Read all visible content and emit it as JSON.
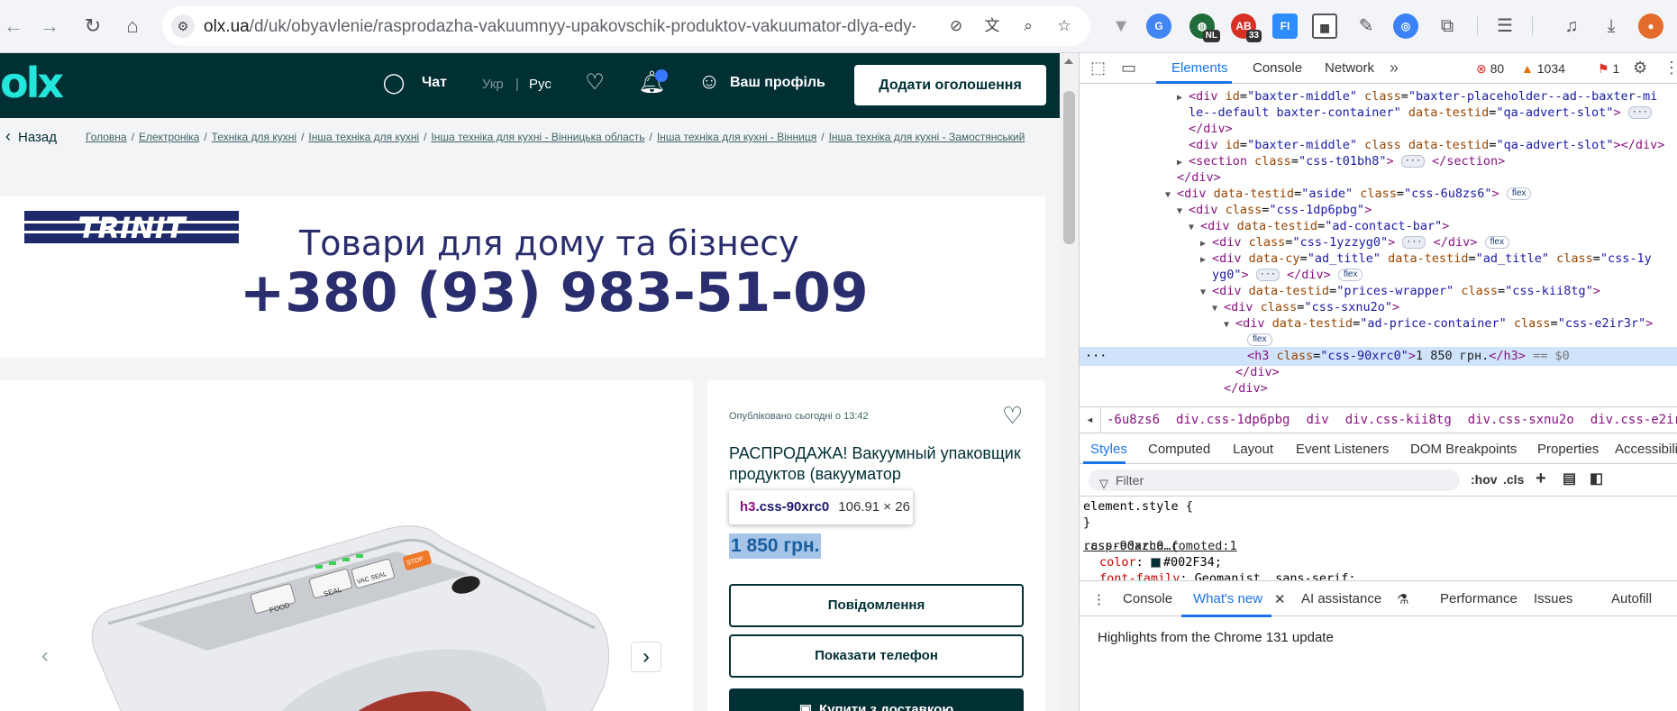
{
  "browser": {
    "url_host": "olx.ua",
    "url_path": "/d/uk/obyavlenie/rasprodazha-vakuumnyy-upakovschik-produktov-vakuumator-dlya-edy-IDMFj...",
    "extensions": [
      {
        "name": "google-translate-ext",
        "label": "G",
        "color": "#4285f4"
      },
      {
        "name": "vpn-ext",
        "label": "NL",
        "color": "#1f6b3a"
      },
      {
        "name": "adblock-ext",
        "label": "33",
        "color": "#d93025"
      },
      {
        "name": "fi-ext",
        "label": "FI",
        "color": "#2d8cff"
      },
      {
        "name": "qr-ext",
        "label": "QR",
        "color": "#555555"
      }
    ]
  },
  "olx": {
    "logo": "olx",
    "chat": "Чат",
    "lang_ukr": "Укр",
    "lang_sep": "|",
    "lang_rus": "Рус",
    "profile": "Ваш профіль",
    "post_ad": "Додати оголошення",
    "back": "Назад",
    "breadcrumbs": [
      "Головна",
      "Електроніка",
      "Техніка для кухні",
      "Інша техніка для кухні",
      "Інша техніка для кухні - Вінницька область",
      "Інша техніка для кухні - Вінниця",
      "Інша техніка для кухні - Замостянський"
    ],
    "banner": {
      "brand": "TRINIT",
      "line1": "Товари для дому та бізнесу",
      "phone": "+380 (93) 983-51-09"
    },
    "product_labels": {
      "food": "FOOD",
      "seal": "SEAL",
      "vac_seal": "VAC SEAL",
      "stop": "STOP"
    },
    "ad": {
      "posted": "Опубліковано сьогодні о 13:42",
      "title": "РАСПРОДАЖА! Вакуумный упаковщик продуктов (вакууматор",
      "price": "1 850 грн.",
      "btn_message": "Повідомлення",
      "btn_phone": "Показати телефон",
      "btn_buy": "Купити з доставкою"
    },
    "tooltip": {
      "tag": "h3",
      "cls": ".css-90xrc0",
      "dims": "106.91 × 26"
    }
  },
  "devtools": {
    "tabs": [
      "Elements",
      "Console",
      "Network"
    ],
    "errors": "80",
    "warnings": "1034",
    "issues": "1",
    "dom": [
      {
        "indent": 0,
        "tri": "▶",
        "html": "<span class='t-tag'>&lt;div</span> <span class='t-attr'>id</span>=<span class='t-val'>\"baxter-middle\"</span> <span class='t-attr'>class</span>=<span class='t-val'>\"baxter-placeholder--ad--baxter-mi</span>"
      },
      {
        "indent": 0,
        "tri": "",
        "html": "<span class='t-val'>le--default baxter-container\"</span> <span class='t-attr'>data-testid</span>=<span class='t-val'>\"qa-advert-slot\"</span><span class='t-tag'>&gt;</span> <span class='t-ell'>···</span>"
      },
      {
        "indent": 0,
        "tri": "",
        "html": "<span class='t-tag'>&lt;/div&gt;</span>"
      },
      {
        "indent": 0,
        "tri": "",
        "html": "<span class='t-tag'>&lt;div</span> <span class='t-attr'>id</span>=<span class='t-val'>\"baxter-middle\"</span> <span class='t-attr'>class</span> <span class='t-attr'>data-testid</span>=<span class='t-val'>\"qa-advert-slot\"</span><span class='t-tag'>&gt;&lt;/div&gt;</span>"
      },
      {
        "indent": 0,
        "tri": "▶",
        "html": "<span class='t-tag'>&lt;section</span> <span class='t-attr'>class</span>=<span class='t-val'>\"css-t01bh8\"</span><span class='t-tag'>&gt;</span> <span class='t-ell'>···</span> <span class='t-tag'>&lt;/section&gt;</span>"
      },
      {
        "indent": -1,
        "tri": "",
        "html": "<span class='t-tag'>&lt;/div&gt;</span>"
      },
      {
        "indent": -1,
        "tri": "▼",
        "html": "<span class='t-tag'>&lt;div</span> <span class='t-attr'>data-testid</span>=<span class='t-val'>\"aside\"</span> <span class='t-attr'>class</span>=<span class='t-val'>\"css-6u8zs6\"</span><span class='t-tag'>&gt;</span> <span class='t-badge'>flex</span>"
      },
      {
        "indent": 0,
        "tri": "▼",
        "html": "<span class='t-tag'>&lt;div</span> <span class='t-attr'>class</span>=<span class='t-val'>\"css-1dp6pbg\"</span><span class='t-tag'>&gt;</span>"
      },
      {
        "indent": 1,
        "tri": "▼",
        "html": "<span class='t-tag'>&lt;div</span> <span class='t-attr'>data-testid</span>=<span class='t-val'>\"ad-contact-bar\"</span><span class='t-tag'>&gt;</span>"
      },
      {
        "indent": 2,
        "tri": "▶",
        "html": "<span class='t-tag'>&lt;div</span> <span class='t-attr'>class</span>=<span class='t-val'>\"css-1yzzyg0\"</span><span class='t-tag'>&gt;</span> <span class='t-ell'>···</span> <span class='t-tag'>&lt;/div&gt;</span> <span class='t-badge'>flex</span>"
      },
      {
        "indent": 2,
        "tri": "▶",
        "html": "<span class='t-tag'>&lt;div</span> <span class='t-attr'>data-cy</span>=<span class='t-val'>\"ad_title\"</span> <span class='t-attr'>data-testid</span>=<span class='t-val'>\"ad_title\"</span> <span class='t-attr'>class</span>=<span class='t-val'>\"css-1y</span>"
      },
      {
        "indent": 2,
        "tri": "",
        "html": "<span class='t-val'>yg0\"</span><span class='t-tag'>&gt;</span> <span class='t-ell'>···</span> <span class='t-tag'>&lt;/div&gt;</span> <span class='t-badge'>flex</span>"
      },
      {
        "indent": 2,
        "tri": "▼",
        "html": "<span class='t-tag'>&lt;div</span> <span class='t-attr'>data-testid</span>=<span class='t-val'>\"prices-wrapper\"</span> <span class='t-attr'>class</span>=<span class='t-val'>\"css-kii8tg\"</span><span class='t-tag'>&gt;</span>"
      },
      {
        "indent": 3,
        "tri": "▼",
        "html": "<span class='t-tag'>&lt;div</span> <span class='t-attr'>class</span>=<span class='t-val'>\"css-sxnu2o\"</span><span class='t-tag'>&gt;</span>"
      },
      {
        "indent": 4,
        "tri": "▼",
        "html": "<span class='t-tag'>&lt;div</span> <span class='t-attr'>data-testid</span>=<span class='t-val'>\"ad-price-container\"</span> <span class='t-attr'>class</span>=<span class='t-val'>\"css-e2ir3r\"</span><span class='t-tag'>&gt;</span>"
      },
      {
        "indent": 5,
        "tri": "",
        "html": "<span class='t-badge'>flex</span>"
      },
      {
        "indent": 5,
        "tri": "",
        "sel": true,
        "html": "<span class='t-tag'>&lt;h3</span> <span class='t-attr'>class</span>=<span class='t-val'>\"css-90xrc0\"</span><span class='t-tag'>&gt;</span><span class='t-txt'>1 850 грн.</span><span class='t-tag'>&lt;/h3&gt;</span> <span class='t-eq'>== $0</span>"
      },
      {
        "indent": 4,
        "tri": "",
        "html": "<span class='t-tag'>&lt;/div&gt;</span>"
      },
      {
        "indent": 3,
        "tri": "",
        "html": "<span class='t-tag'>&lt;/div&gt;</span>"
      }
    ],
    "crumbs": [
      "-6u8zs6",
      "div.css-1dp6pbg",
      "div",
      "div.css-kii8tg",
      "div.css-sxnu2o",
      "div.css-e2ir3r",
      "h3.css-90xrc0"
    ],
    "subtabs": [
      "Styles",
      "Computed",
      "Layout",
      "Event Listeners",
      "DOM Breakpoints",
      "Properties",
      "Accessibili"
    ],
    "filter_placeholder": "Filter",
    "filter_hov": ":hov",
    "filter_cls": ".cls",
    "styles": {
      "element_style": "element.style {",
      "close": "}",
      "rule_selector": ".css-90xrc0 {",
      "rule_source": "rasprodazha…romoted:1",
      "color_prop": "color",
      "color_val": "#002F34;",
      "font_prop": "font-family",
      "font_val": "Geomanist, sans-serif;"
    },
    "drawer_tabs": [
      "Console",
      "What's new",
      "AI assistance",
      "Performance",
      "Issues",
      "Autofill"
    ],
    "drawer_body": "Highlights from the Chrome 131 update"
  }
}
